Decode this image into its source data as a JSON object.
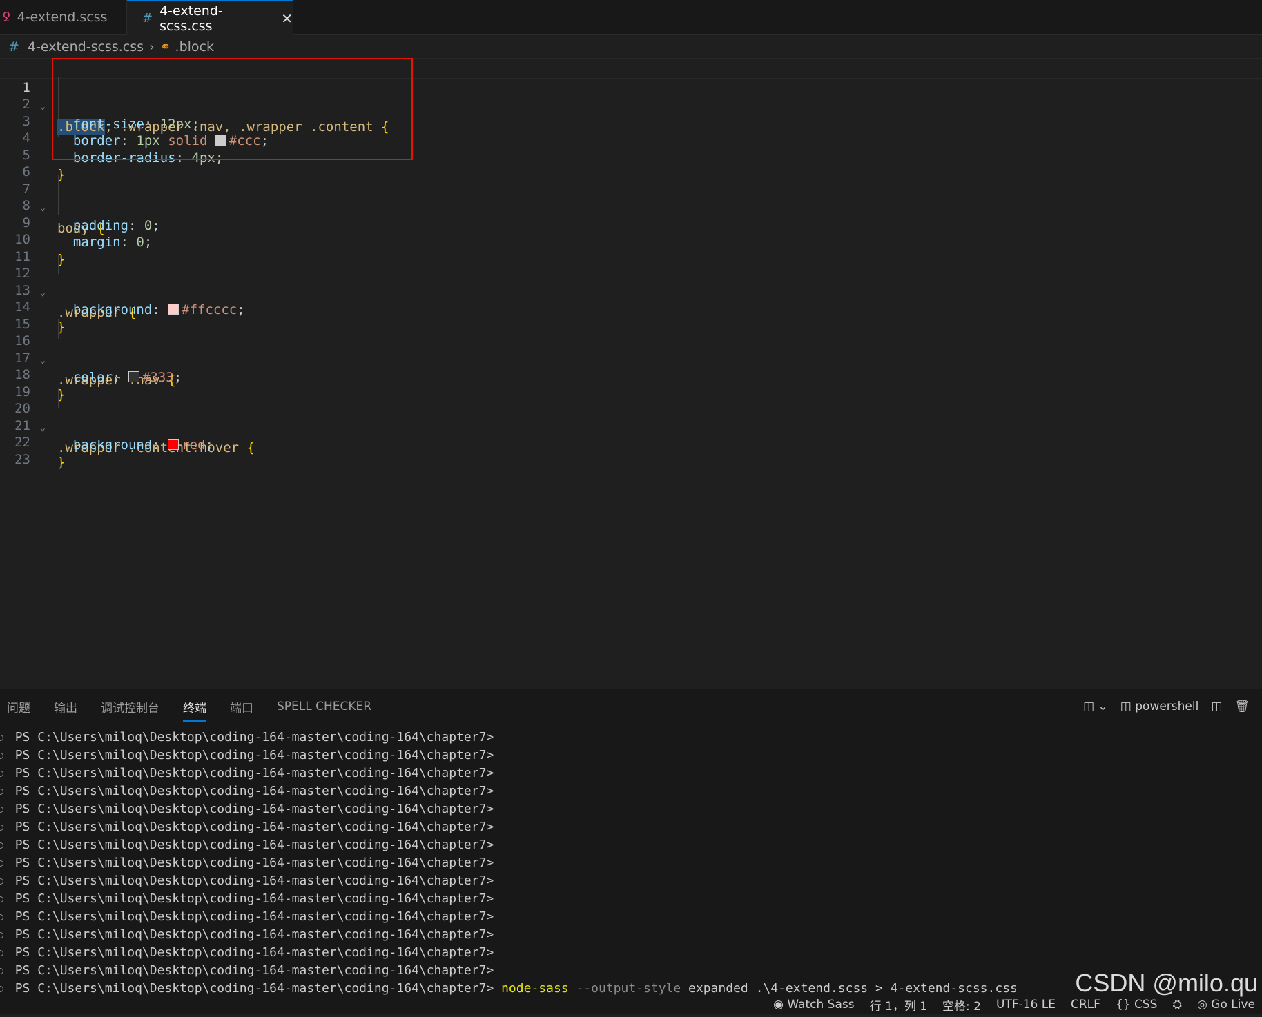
{
  "tabs": [
    {
      "icon": "sass-icon",
      "label": "4-extend.scss"
    },
    {
      "icon": "hash-icon",
      "label": "4-extend-scss.css",
      "close": "✕"
    }
  ],
  "breadcrumb": {
    "file": "4-extend-scss.css",
    "symbol": ".block"
  },
  "editor": {
    "line_numbers": [
      "1",
      "2",
      "3",
      "4",
      "5",
      "6",
      "7",
      "8",
      "9",
      "10",
      "11",
      "12",
      "13",
      "14",
      "15",
      "16",
      "17",
      "18",
      "19",
      "20",
      "21",
      "22",
      "23"
    ],
    "rules": {
      "r1": {
        "selector_hl": ".block",
        "selector_rest": ", .wrapper .nav, .wrapper .content",
        "open": "{",
        "close": "}",
        "d1": {
          "prop": "font-size",
          "value": "12px"
        },
        "d2": {
          "prop": "border",
          "v1": "1px",
          "v2": "solid",
          "swatch": "#cccccc",
          "color": "#ccc"
        },
        "d3": {
          "prop": "border-radius",
          "value": "4px"
        }
      },
      "r2": {
        "selector": "body",
        "open": "{",
        "close": "}",
        "d1": {
          "prop": "padding",
          "value": "0"
        },
        "d2": {
          "prop": "margin",
          "value": "0"
        }
      },
      "r3": {
        "selector": ".wrapper",
        "open": "{",
        "close": "}",
        "d1": {
          "prop": "background",
          "swatch": "#ffcccc",
          "value": "#ffcccc"
        }
      },
      "r4": {
        "selector": ".wrapper .nav",
        "open": "{",
        "close": "}",
        "d1": {
          "prop": "color",
          "swatch": "#333333",
          "value": "#333"
        }
      },
      "r5": {
        "selector": ".wrapper .content:hover",
        "open": "{",
        "close": "}",
        "d1": {
          "prop": "background",
          "swatch": "#ff0000",
          "value": "red"
        }
      }
    }
  },
  "panel": {
    "tabs": [
      "问题",
      "输出",
      "调试控制台",
      "终端",
      "端口",
      "SPELL CHECKER"
    ],
    "active_tab": "终端",
    "shell": "powershell",
    "terminal": {
      "prompt": "PS C:\\Users\\miloq\\Desktop\\coding-164-master\\coding-164\\chapter7>",
      "command": {
        "bin": "node-sass",
        "flag": "--output-style",
        "rest": "expanded .\\4-extend.scss > 4-extend-scss.css"
      }
    }
  },
  "statusbar": {
    "watch_sass": "Watch Sass",
    "position": "行 1，列 1",
    "spaces": "空格: 2",
    "encoding": "UTF-16 LE",
    "eol": "CRLF",
    "language": "CSS",
    "go_live": "Go Live"
  },
  "watermark": "CSDN @milo.qu"
}
